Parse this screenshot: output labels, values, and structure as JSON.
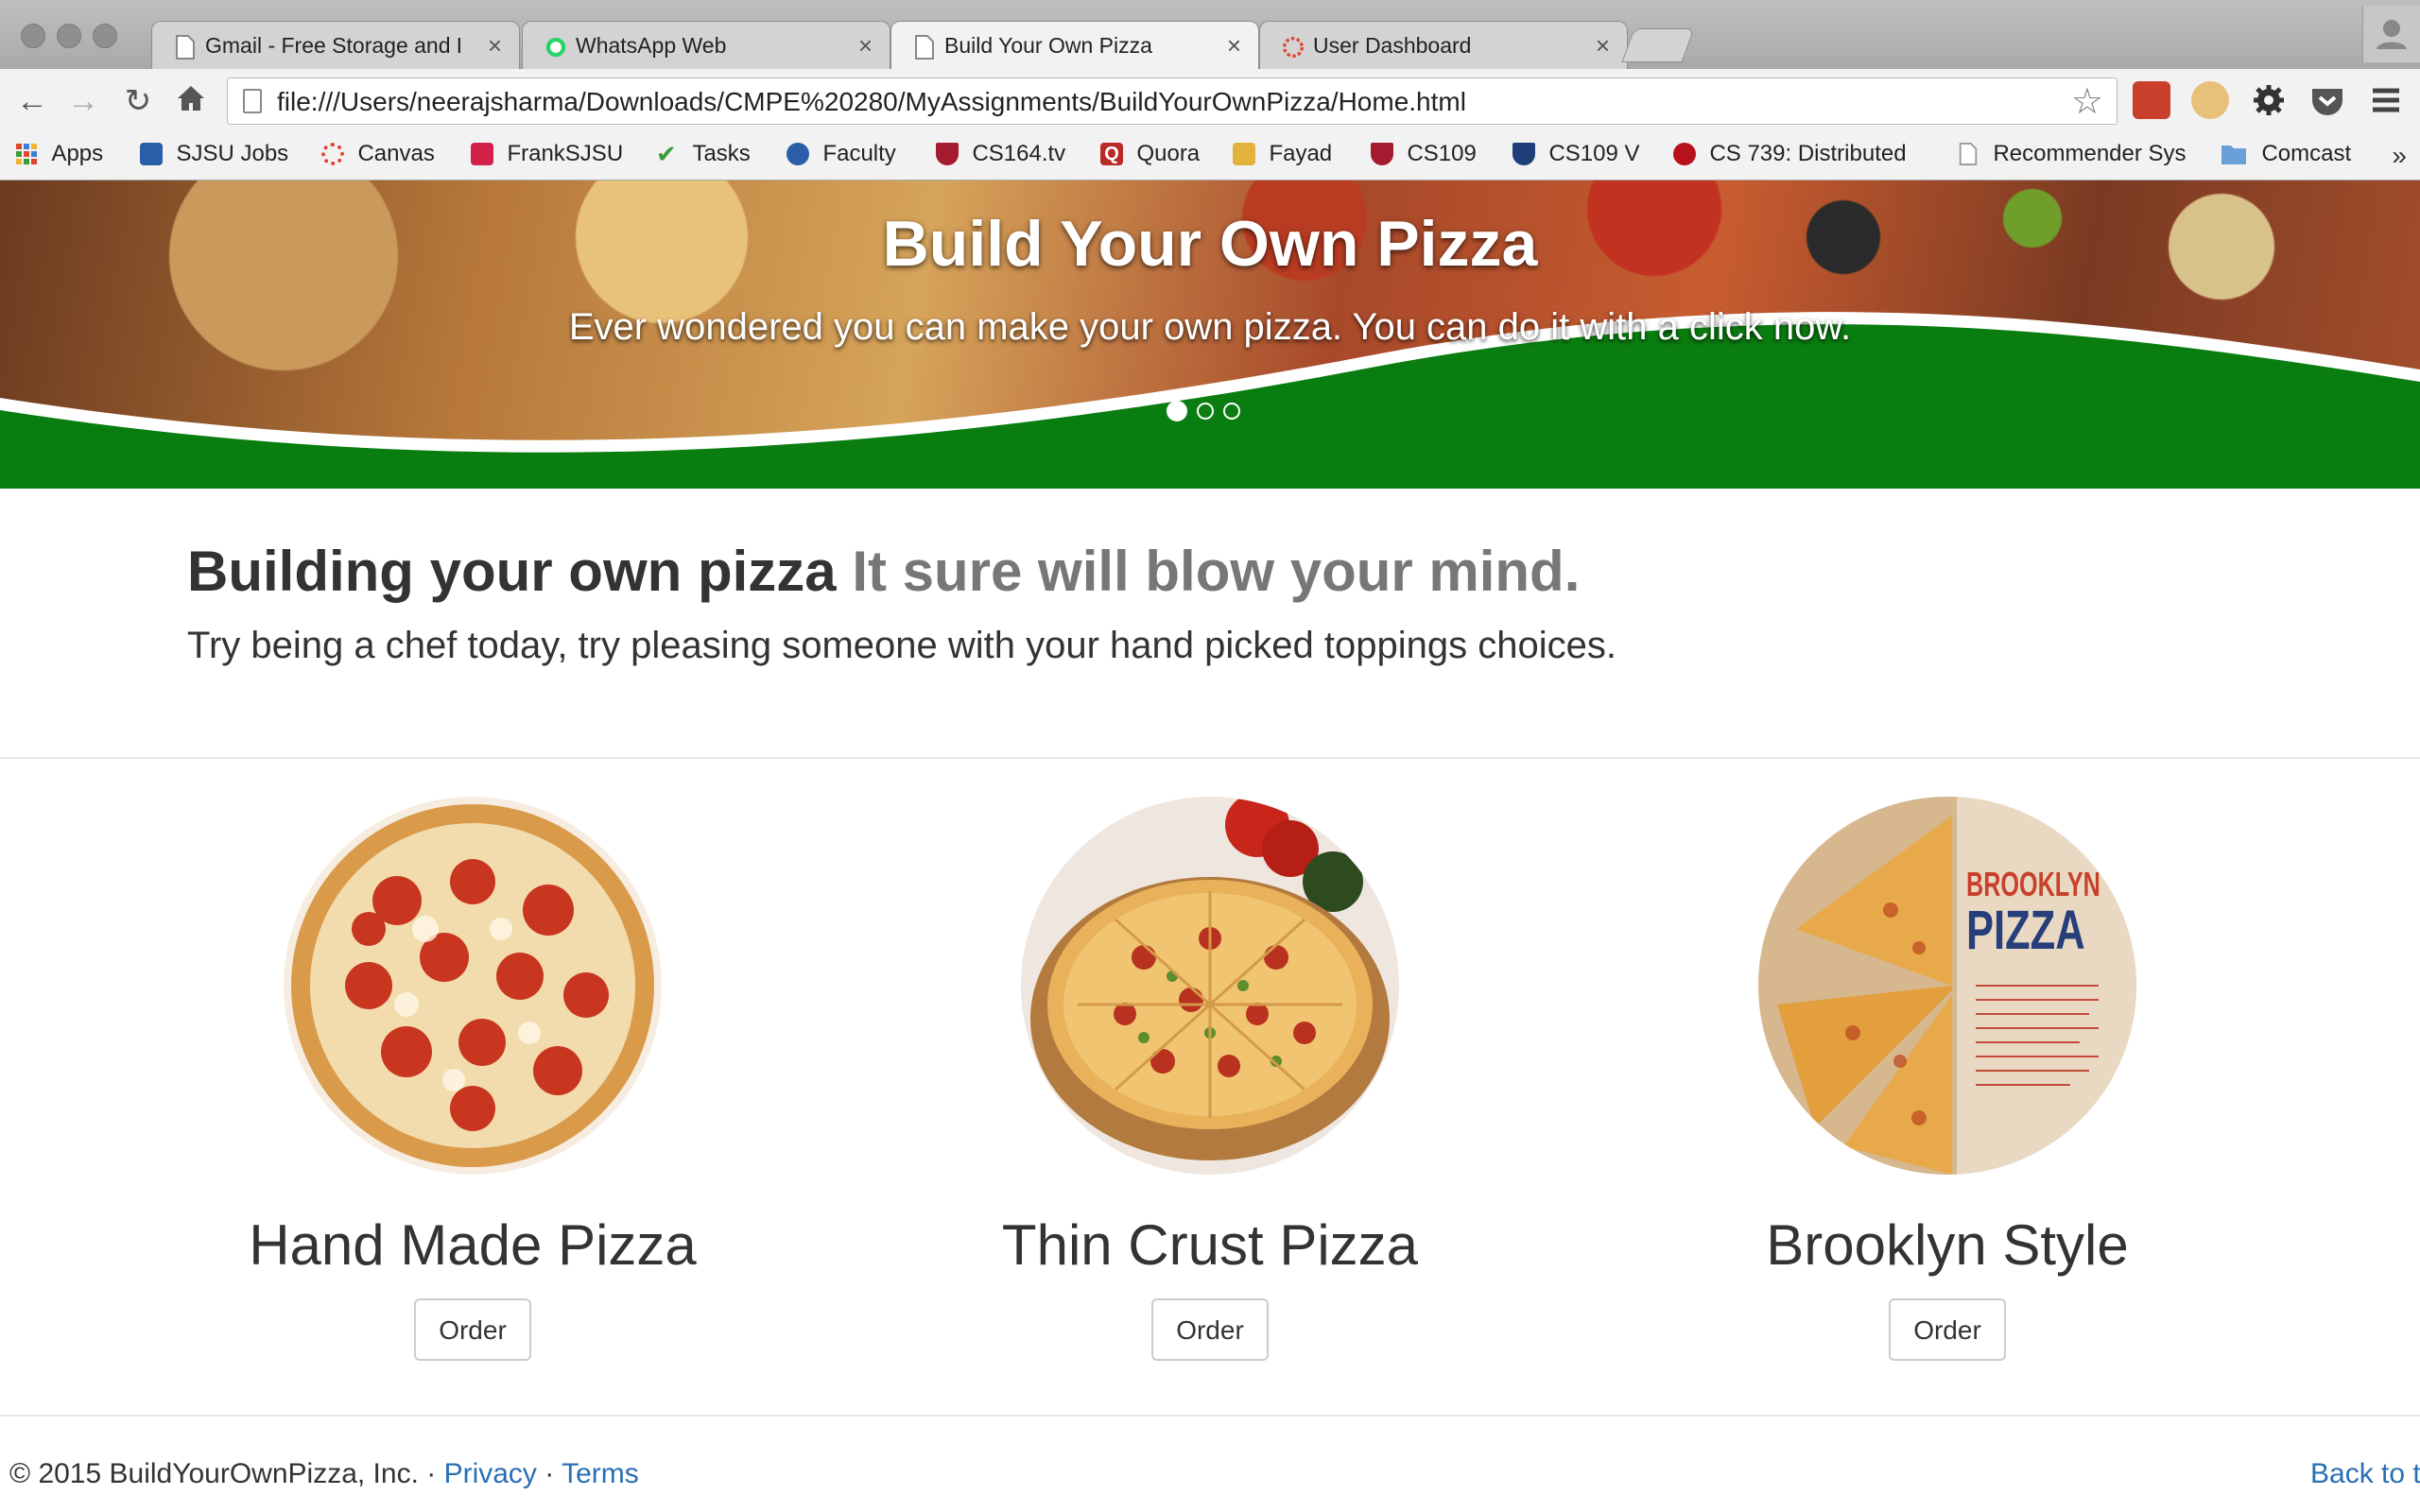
{
  "browser": {
    "tabs": [
      {
        "title": "Gmail - Free Storage and E",
        "icon": "document-icon",
        "active": false
      },
      {
        "title": "WhatsApp Web",
        "icon": "whatsapp-icon",
        "active": false
      },
      {
        "title": "Build Your Own Pizza",
        "icon": "document-icon",
        "active": true
      },
      {
        "title": "User Dashboard",
        "icon": "sjsu-icon",
        "active": false
      }
    ],
    "tab_close": "×",
    "url": "file:///Users/neerajsharma/Downloads/CMPE%20280/MyAssignments/BuildYourOwnPizza/Home.html",
    "bookmarks": [
      {
        "label": "Apps",
        "icon": "apps-grid-icon",
        "color": "#e0452f"
      },
      {
        "label": "SJSU Jobs",
        "icon": "sjsu-jobs-icon",
        "color": "#2b5ea8"
      },
      {
        "label": "Canvas",
        "icon": "canvas-icon",
        "color": "#e0452f"
      },
      {
        "label": "FrankSJSU",
        "icon": "franksjsu-icon",
        "color": "#d2224a"
      },
      {
        "label": "Tasks",
        "icon": "checkmark-icon",
        "color": "#3a9b3a"
      },
      {
        "label": "Faculty",
        "icon": "faculty-icon",
        "color": "#2b5ea8"
      },
      {
        "label": "CS164.tv",
        "icon": "harvard-shield-icon",
        "color": "#a51c30"
      },
      {
        "label": "Quora",
        "icon": "quora-icon",
        "color": "#b92b27"
      },
      {
        "label": "Fayad",
        "icon": "fayad-icon",
        "color": "#e3b23c"
      },
      {
        "label": "CS109",
        "icon": "harvard-shield-icon",
        "color": "#a51c30"
      },
      {
        "label": "CS109 V",
        "icon": "shield-icon",
        "color": "#1f3f7a"
      },
      {
        "label": "CS 739: Distributed",
        "icon": "wisconsin-icon",
        "color": "#b5121b"
      },
      {
        "label": "Recommender Sys",
        "icon": "document-icon",
        "color": "#ffffff"
      },
      {
        "label": "Comcast",
        "icon": "folder-icon",
        "color": "#6aa0d8"
      }
    ],
    "bookmarks_more": "»"
  },
  "hero": {
    "title": "Build Your Own Pizza",
    "subtitle": "Ever wondered you can make your own pizza. You can do it with a click now.",
    "active_slide": 1,
    "slide_count": 3,
    "accent_color": "#0a7d10"
  },
  "intro": {
    "heading": "Building your own pizza",
    "heading_muted": "It sure will blow your mind.",
    "lead": "Try being a chef today, try pleasing someone with your hand picked toppings choices."
  },
  "pizzas": [
    {
      "name": "Hand Made Pizza",
      "button": "Order"
    },
    {
      "name": "Thin Crust Pizza",
      "button": "Order"
    },
    {
      "name": "Brooklyn Style",
      "button": "Order",
      "box_text_1": "BROOKLYN",
      "box_text_2": "PIZZA"
    }
  ],
  "footer": {
    "copyright": "© 2015 BuildYourOwnPizza, Inc. ·",
    "privacy": "Privacy",
    "separator": "·",
    "terms": "Terms",
    "back_to_top": "Back to t",
    "link_color": "#2a6fb3"
  }
}
